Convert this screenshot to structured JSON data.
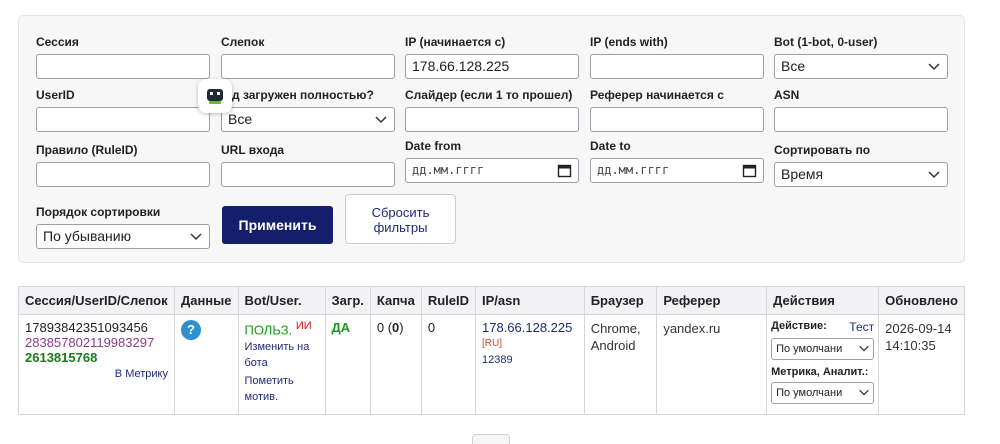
{
  "filters": {
    "session": {
      "label": "Сессия",
      "value": ""
    },
    "slepok": {
      "label": "Слепок",
      "value": ""
    },
    "ip_starts": {
      "label": "IP (начинается с)",
      "value": "178.66.128.225"
    },
    "ip_ends": {
      "label": "IP (ends with)",
      "value": ""
    },
    "bot": {
      "label": "Bot (1-bot, 0-user)",
      "value": "Все"
    },
    "userid": {
      "label": "UserID",
      "value": ""
    },
    "loaded": {
      "label": "д загружен полностью?",
      "value": "Все"
    },
    "slider": {
      "label": "Слайдер (если 1 то прошел)",
      "value": ""
    },
    "referer": {
      "label": "Реферер начинается с",
      "value": ""
    },
    "asn": {
      "label": "ASN",
      "value": ""
    },
    "rule": {
      "label": "Правило (RuleID)",
      "value": ""
    },
    "url": {
      "label": "URL входа",
      "value": ""
    },
    "date_from": {
      "label": "Date from",
      "placeholder": "дд.мм.гггг"
    },
    "date_to": {
      "label": "Date to",
      "placeholder": "дд.мм.гггг"
    },
    "sort_by": {
      "label": "Сортировать по",
      "value": "Время"
    },
    "sort_order": {
      "label": "Порядок сортировки",
      "value": "По убыванию"
    },
    "apply_label": "Применить",
    "reset_label_1": "Сбросить",
    "reset_label_2": "фильтры"
  },
  "table": {
    "headers": [
      "Сессия/UserID/Слепок",
      "Данные",
      "Bot/User.",
      "Загр.",
      "Капча",
      "RuleID",
      "IP/asn",
      "Браузер",
      "Реферер",
      "Действия",
      "Обновлено"
    ],
    "row": {
      "session": "17893842351093456",
      "userid": "283857802119983297",
      "slepok": "2613815768",
      "metrika_link": "В Метрику",
      "data_icon": "?",
      "user_type": "ПОЛЬЗ.",
      "user_mark": "ИИ",
      "change_link_1": "Изменить на",
      "change_link_2": "бота",
      "mark_link_1": "Пометить",
      "mark_link_2": "мотив.",
      "loaded": "ДА",
      "captcha_prefix": "0 (",
      "captcha_bold": "0",
      "captcha_suffix": ")",
      "ruleid": "0",
      "ip": "178.66.128.225",
      "country": "[RU]",
      "asn": "12389",
      "browser_1": "Chrome,",
      "browser_2": "Android",
      "referer": "yandex.ru",
      "action_label": "Действие:",
      "action_test": "Тест",
      "action_select": "По умолчани",
      "metrika_label": "Метрика, Аналит.:",
      "metrika_select": "По умолчани",
      "updated_1": "2026-09-14",
      "updated_2": "14:10:35"
    }
  },
  "icons": {
    "robot": "robot-icon",
    "chevron": "chevron-down-icon",
    "calendar": "calendar-icon",
    "help": "question-icon"
  },
  "colors": {
    "primary": "#131f6b",
    "green": "#1b9a1b",
    "purple": "#8e3a8e",
    "link": "#1d2a7a"
  }
}
